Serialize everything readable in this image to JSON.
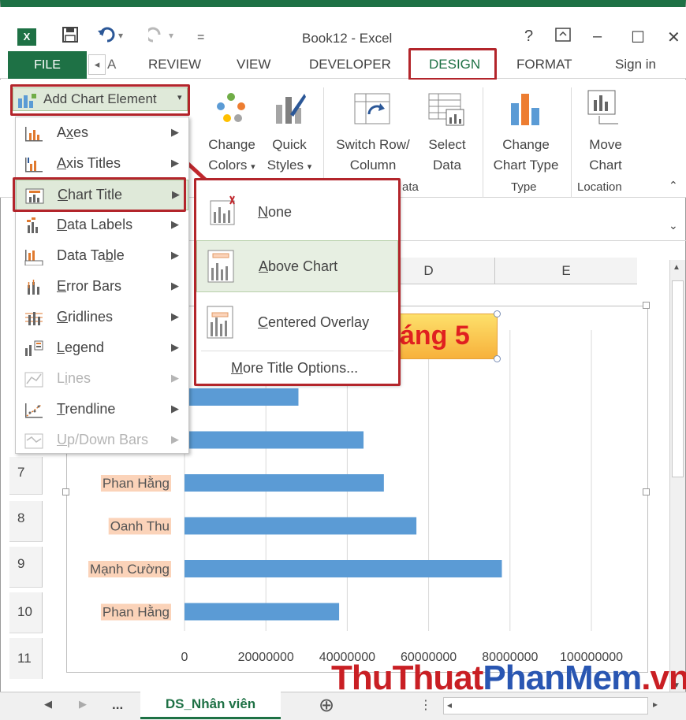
{
  "app": {
    "title": "Book12 - Excel",
    "logo": "X",
    "help": "?",
    "controls": [
      "–",
      "☐",
      "✕"
    ]
  },
  "tabs": {
    "file": "FILE",
    "partial": "A",
    "items": [
      "REVIEW",
      "VIEW",
      "DEVELOPER",
      "DESIGN",
      "FORMAT"
    ],
    "signin": "Sign in"
  },
  "ribbon": {
    "add_chart_element": "Add Chart Element",
    "change_colors": [
      "Change",
      "Colors"
    ],
    "quick_styles": [
      "Quick",
      "Styles"
    ],
    "switch_row": [
      "Switch Row/",
      "Column"
    ],
    "select_data": [
      "Select",
      "Data"
    ],
    "change_chart_type": [
      "Change",
      "Chart Type"
    ],
    "move_chart": [
      "Move",
      "Chart"
    ],
    "groups": {
      "data": "ata",
      "type": "Type",
      "location": "Location"
    }
  },
  "menu": {
    "items": [
      {
        "label": "Axes",
        "u": "x",
        "disabled": false
      },
      {
        "label": "Axis Titles",
        "u": "A",
        "disabled": false
      },
      {
        "label": "Chart Title",
        "u": "C",
        "disabled": false
      },
      {
        "label": "Data Labels",
        "u": "D",
        "disabled": false
      },
      {
        "label": "Data Table",
        "u": "b",
        "disabled": false
      },
      {
        "label": "Error Bars",
        "u": "E",
        "disabled": false
      },
      {
        "label": "Gridlines",
        "u": "G",
        "disabled": false
      },
      {
        "label": "Legend",
        "u": "L",
        "disabled": false
      },
      {
        "label": "Lines",
        "u": "i",
        "disabled": true
      },
      {
        "label": "Trendline",
        "u": "T",
        "disabled": false
      },
      {
        "label": "Up/Down Bars",
        "u": "U",
        "disabled": true
      }
    ]
  },
  "submenu": {
    "none": "None",
    "above_chart": "Above Chart",
    "centered_overlay": "Centered Overlay",
    "more": "More Title Options..."
  },
  "grid": {
    "columns": [
      "D",
      "E"
    ],
    "rows": [
      "7",
      "8",
      "9",
      "10",
      "11"
    ]
  },
  "chart_data": {
    "type": "bar",
    "title": "áng 5",
    "categories": [
      "",
      "",
      "Phan Hằng",
      "Oanh Thu",
      "Mạnh Cường",
      "Phan Hằng"
    ],
    "values": [
      28000000,
      44000000,
      49000000,
      57000000,
      78000000,
      38000000
    ],
    "xlim": [
      0,
      100000000
    ],
    "ticks": [
      "0",
      "20000000",
      "40000000",
      "60000000",
      "80000000",
      "100000000"
    ],
    "bar_color": "#5b9bd5",
    "label_bg": "#fbd3b9",
    "grid": true
  },
  "sheets": {
    "more": "...",
    "active": "DS_Nhân viên",
    "add": "⊕"
  },
  "watermark": {
    "red": "ThuThuat",
    "blue": "PhanMem",
    "tail": ".vn"
  },
  "colors": {
    "excel_green": "#1e7145",
    "highlight_red": "#b3252b"
  }
}
